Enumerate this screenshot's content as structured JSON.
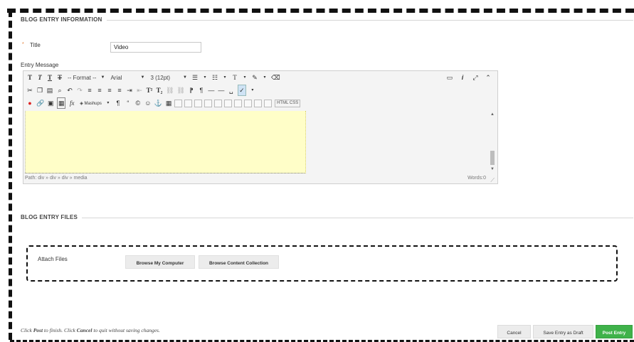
{
  "section_entry_info": "BLOG ENTRY INFORMATION",
  "title_field": {
    "required_mark": "*",
    "label": "Title",
    "value": "Video"
  },
  "entry_message_label": "Entry Message",
  "editor": {
    "row1": {
      "format_select": "-- Format --",
      "font_select": "Arial",
      "size_select": "3 (12pt)"
    },
    "row3": {
      "mashups_label": "Mashups",
      "html_css_label": "HTML CSS"
    },
    "status": {
      "path": "Path: div » div » div » media",
      "words": "Words:0"
    }
  },
  "section_files": "BLOG ENTRY FILES",
  "attach": {
    "label": "Attach Files",
    "browse_computer": "Browse My Computer",
    "browse_collection": "Browse Content Collection"
  },
  "footer": {
    "p1": "Click ",
    "post": "Post",
    "p2": " to finish. Click ",
    "cancel": "Cancel",
    "p3": " to quit without saving changes."
  },
  "actions": {
    "cancel": "Cancel",
    "save_draft": "Save Entry as Draft",
    "post": "Post Entry"
  },
  "colors": {
    "post_button": "#3fb24a",
    "editor_area": "#fffec8",
    "required": "#e27b2e"
  }
}
